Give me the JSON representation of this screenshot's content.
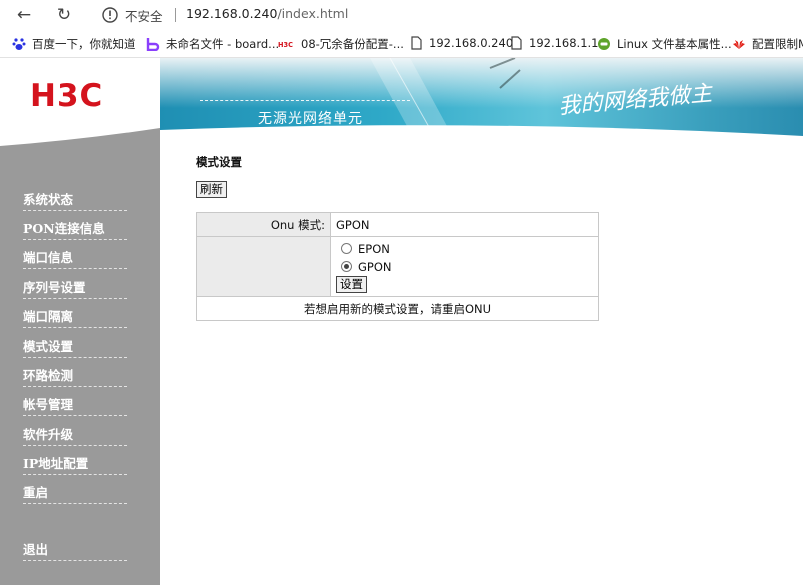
{
  "browser": {
    "insecure_label": "不安全",
    "url_host": "192.168.0.240",
    "url_path": "/index.html",
    "bookmarks": [
      {
        "label": "百度一下，你就知道",
        "icon": "baidu-icon"
      },
      {
        "label": "未命名文件 - board...",
        "icon": "board-icon"
      },
      {
        "label": "08-冗余备份配置-...",
        "icon": "h3c-icon"
      },
      {
        "label": "192.168.0.240",
        "icon": "page-icon"
      },
      {
        "label": "192.168.1.1",
        "icon": "page-icon"
      },
      {
        "label": "Linux 文件基本属性...",
        "icon": "runoob-icon"
      },
      {
        "label": "配置限制M",
        "icon": "huawei-icon"
      }
    ]
  },
  "header": {
    "logo": "H3C",
    "subtitle": "无源光网络单元",
    "slogan": "我的网络我做主"
  },
  "sidebar": {
    "items": [
      "系统状态",
      "PON连接信息",
      "端口信息",
      "序列号设置",
      "端口隔离",
      "模式设置",
      "环路检测",
      "帐号管理",
      "软件升级",
      "IP地址配置",
      "重启"
    ],
    "logout": "退出"
  },
  "main": {
    "title": "模式设置",
    "refresh_label": "刷新",
    "mode_label": "Onu 模式:",
    "mode_value": "GPON",
    "options": [
      {
        "label": "EPON",
        "selected": false
      },
      {
        "label": "GPON",
        "selected": true
      }
    ],
    "set_label": "设置",
    "note": "若想启用新的模式设置，请重启ONU"
  }
}
